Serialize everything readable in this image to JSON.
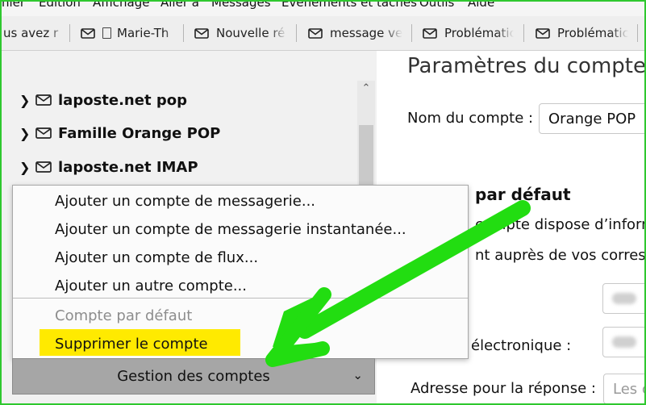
{
  "menubar": {
    "items": [
      "hier",
      "Édition",
      "Affichage",
      "Aller à",
      "Messages",
      "Évènements et tâches",
      "Outils",
      "Aide"
    ]
  },
  "tabs": [
    {
      "label": "us avez r",
      "icon": "none"
    },
    {
      "label": "Marie-Th",
      "icon": "envelope-doc"
    },
    {
      "label": "Nouvelle ré",
      "icon": "envelope"
    },
    {
      "label": "message ve",
      "icon": "envelope"
    },
    {
      "label": "Problématic",
      "icon": "envelope"
    },
    {
      "label": "Problématic",
      "icon": "envelope"
    }
  ],
  "sidebar": {
    "accounts": [
      {
        "name": "laposte.net pop"
      },
      {
        "name": "Famille Orange POP"
      },
      {
        "name": "laposte.net IMAP"
      }
    ]
  },
  "popup_menu": {
    "items": [
      {
        "label": "Ajouter un compte de messagerie...",
        "enabled": true
      },
      {
        "label": "Ajouter un compte de messagerie instantanée...",
        "enabled": true
      },
      {
        "label": "Ajouter un compte de flux...",
        "enabled": true
      },
      {
        "label": "Ajouter un autre compte...",
        "enabled": true
      }
    ],
    "items_after_separator": [
      {
        "label": "Compte par défaut",
        "enabled": false
      },
      {
        "label": "Supprimer le compte",
        "enabled": true,
        "highlighted": true
      }
    ]
  },
  "manage_button": {
    "label": "Gestion des comptes"
  },
  "settings": {
    "title": "Paramètres du compte",
    "account_name_label": "Nom du compte :",
    "account_name_value": "Orange POP",
    "section_title": "par défaut",
    "desc_line1": "compte dispose d’inform",
    "desc_line2": "nt auprès de vos corresp",
    "email_label": "électronique :",
    "reply_label": "Adresse pour la réponse :",
    "reply_placeholder": "Les c"
  },
  "colors": {
    "highlight": "#ffea00",
    "arrow": "#22dd11",
    "frame": "#2fc82f"
  }
}
